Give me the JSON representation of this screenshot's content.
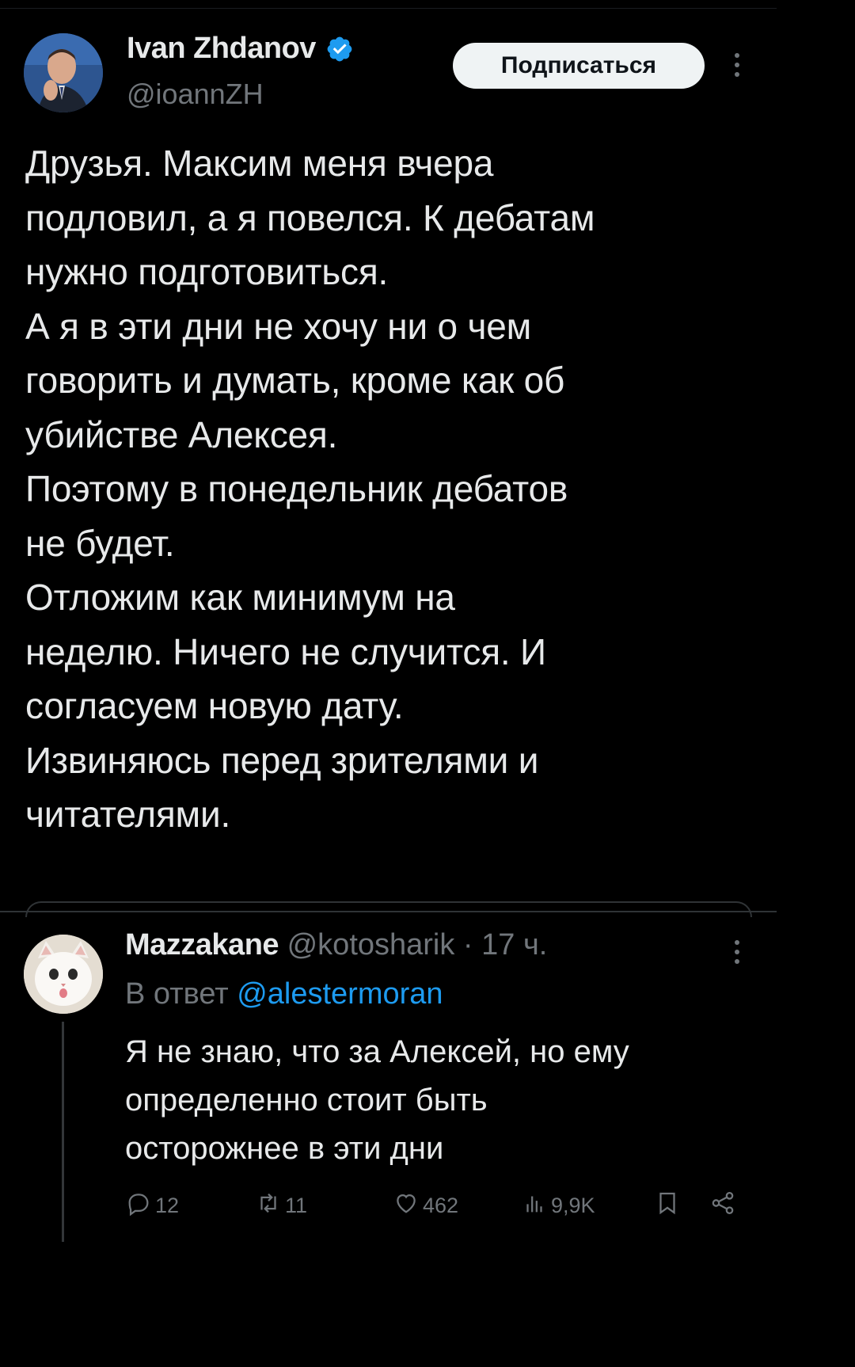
{
  "tweet": {
    "author_name": "Ivan Zhdanov",
    "author_handle": "@ioannZH",
    "subscribe_label": "Подписаться",
    "lines": [
      "Друзья. Максим меня вчера",
      "подловил, а я повелся. К дебатам",
      "нужно подготовиться.",
      "А я в эти дни не хочу ни о чем",
      "говорить и думать, кроме как об",
      "убийстве Алексея.",
      "Поэтому в понедельник дебатов",
      "не будет.",
      "Отложим как минимум на",
      "неделю. Ничего не случится. И",
      "согласуем новую дату.",
      "Извиняюсь перед зрителями и",
      "читателями."
    ]
  },
  "reply": {
    "author_name": "Mazzakane",
    "meta": " @kotosharik · 17 ч.",
    "in_reply_prefix": "В ответ ",
    "in_reply_mention": "@alestermoran",
    "lines": [
      "Я не знаю, что за Алексей, но ему",
      "определенно стоит быть",
      "осторожнее в эти дни"
    ],
    "actions": {
      "replies": "12",
      "reposts": "11",
      "likes": "462",
      "views": "9,9K"
    }
  },
  "colors": {
    "background": "#000000",
    "text": "#e7e9ea",
    "muted": "#71767b",
    "accent": "#1d9bf0",
    "button_bg": "#eff3f4"
  }
}
